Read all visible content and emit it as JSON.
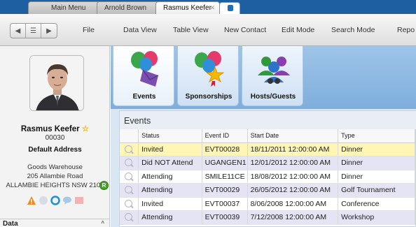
{
  "tabs": [
    {
      "label": "Main Menu",
      "active": false
    },
    {
      "label": "Arnold Brown",
      "active": false
    },
    {
      "label": "Rasmus Keefer",
      "active": true
    }
  ],
  "toolbar": {
    "file": "File",
    "menu": [
      "Data View",
      "Table View",
      "New Contact",
      "Edit Mode",
      "Search Mode",
      "Repo"
    ]
  },
  "contact": {
    "name": "Rasmus Keefer",
    "code": "00030",
    "address_title": "Default Address",
    "address_lines": [
      "Goods Warehouse",
      "205 Allambie Road",
      "ALLAMBIE HEIGHTS NSW 2100"
    ],
    "badge": "R"
  },
  "sidebar": {
    "section_label": "Data"
  },
  "links": [
    {
      "label": "Events",
      "icon": "balloons-envelope-icon"
    },
    {
      "label": "Sponsorships",
      "icon": "balloons-star-icon"
    },
    {
      "label": "Hosts/Guests",
      "icon": "people-group-icon"
    }
  ],
  "events": {
    "title": "Events",
    "columns": [
      "",
      "Status",
      "Event ID",
      "Start Date",
      "Type"
    ],
    "rows": [
      {
        "status": "Invited",
        "event_id": "EVT00028",
        "start_date": "18/11/2011 12:00:00 AM",
        "type": "Dinner"
      },
      {
        "status": "Did NOT Attend",
        "event_id": "UGANGEN1",
        "start_date": "12/01/2012 12:00:00 AM",
        "type": "Dinner"
      },
      {
        "status": "Attending",
        "event_id": "SMILE11CE",
        "start_date": "18/08/2012 12:00:00 AM",
        "type": "Dinner"
      },
      {
        "status": "Attending",
        "event_id": "EVT00029",
        "start_date": "26/05/2012 12:00:00 AM",
        "type": "Golf Tournament"
      },
      {
        "status": "Invited",
        "event_id": "EVT00037",
        "start_date": "8/06/2008 12:00:00 AM",
        "type": "Conference"
      },
      {
        "status": "Attending",
        "event_id": "EVT00039",
        "start_date": "7/12/2008 12:00:00 AM",
        "type": "Workshop"
      }
    ]
  },
  "colors": {
    "tabbar": "#1d5fa0",
    "selected_row": "#fff6b5",
    "alt_row": "#e4e4f5",
    "star": "#f2b400"
  }
}
